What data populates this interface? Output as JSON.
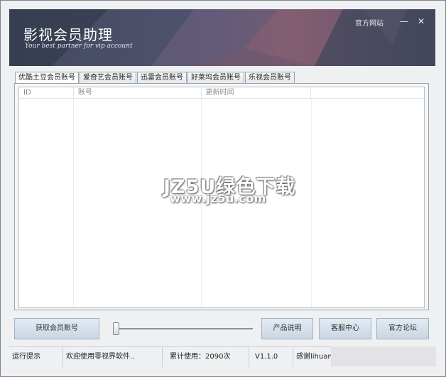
{
  "window": {
    "title": "影视会员助理",
    "slogan": "Your best partner for vip account",
    "official_site": "官方网站",
    "minimize_glyph": "—",
    "close_glyph": "✕"
  },
  "tabs": [
    {
      "label": "优酷土豆会员账号",
      "active": true
    },
    {
      "label": "爱奇艺会员账号",
      "active": false
    },
    {
      "label": "迅雷会员账号",
      "active": false
    },
    {
      "label": "好莱坞会员账号",
      "active": false
    },
    {
      "label": "乐视会员账号",
      "active": false
    }
  ],
  "table": {
    "columns": [
      "ID",
      "账号",
      "更新时间",
      ""
    ],
    "rows": []
  },
  "watermark": {
    "line1": "JZ5U绿色下载",
    "line2": "www.jz5u.com"
  },
  "buttons": {
    "get_account": "获取会员账号",
    "product_info": "产品说明",
    "service_center": "客服中心",
    "official_forum": "官方论坛"
  },
  "slider": {
    "value": 0
  },
  "statusbar": {
    "label": "运行提示",
    "message": "欢迎使用零视界软件..",
    "usage": "累计使用：2090次",
    "version": "V1.1.0",
    "thanks": "感谢lihuan.n"
  }
}
